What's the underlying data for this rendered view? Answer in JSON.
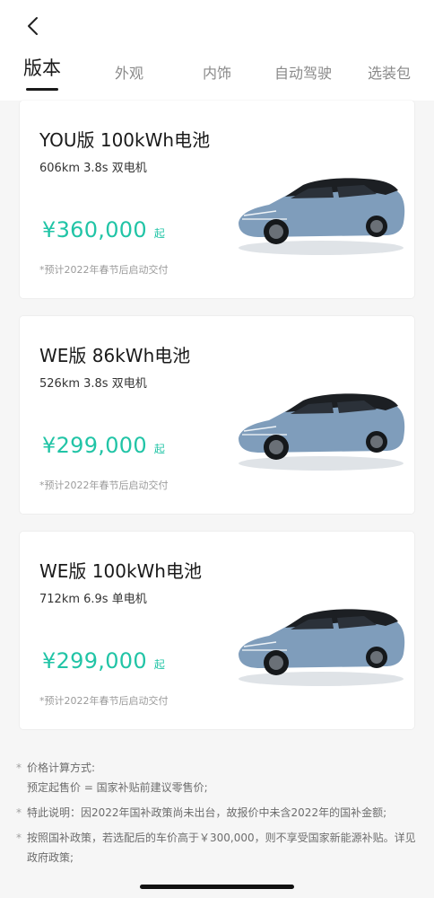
{
  "header": {
    "tabs": [
      "版本",
      "外观",
      "内饰",
      "自动驾驶",
      "选装包"
    ]
  },
  "cards": [
    {
      "title": "YOU版 100kWh电池",
      "specs": "606km 3.8s 双电机",
      "price": "¥360,000",
      "price_suffix": "起",
      "delivery": "*预计2022年春节后启动交付"
    },
    {
      "title": "WE版 86kWh电池",
      "specs": "526km 3.8s 双电机",
      "price": "¥299,000",
      "price_suffix": "起",
      "delivery": "*预计2022年春节后启动交付"
    },
    {
      "title": "WE版 100kWh电池",
      "specs": "712km 6.9s 单电机",
      "price": "¥299,000",
      "price_suffix": "起",
      "delivery": "*预计2022年春节后启动交付"
    }
  ],
  "notes": [
    {
      "star": "*",
      "lines": [
        "价格计算方式:",
        "预定起售价 = 国家补贴前建议零售价;"
      ]
    },
    {
      "star": "*",
      "lines": [
        "特此说明：因2022年国补政策尚未出台，故报价中未含2022年的国补金额;"
      ]
    },
    {
      "star": "*",
      "lines": [
        "按照国补政策，若选配后的车价高于￥300,000，则不享受国家新能源补贴。详见政府政策;"
      ]
    }
  ],
  "colors": {
    "accent": "#21c4a6",
    "car_body": "#7f9dbb",
    "car_roof": "#1c1f23"
  }
}
